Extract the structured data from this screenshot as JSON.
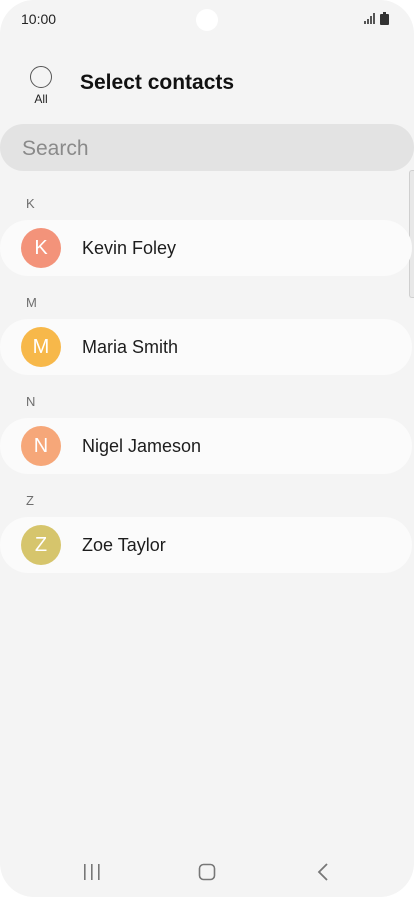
{
  "status_bar": {
    "time": "10:00"
  },
  "header": {
    "select_all_label": "All",
    "title": "Select contacts"
  },
  "search": {
    "placeholder": "Search"
  },
  "sections": [
    {
      "letter": "K",
      "contact": {
        "name": "Kevin Foley",
        "initial": "K",
        "avatar_color": "#f3937a"
      }
    },
    {
      "letter": "M",
      "contact": {
        "name": "Maria Smith",
        "initial": "M",
        "avatar_color": "#f7b84a"
      }
    },
    {
      "letter": "N",
      "contact": {
        "name": "Nigel Jameson",
        "initial": "N",
        "avatar_color": "#f6a779"
      }
    },
    {
      "letter": "Z",
      "contact": {
        "name": "Zoe Taylor",
        "initial": "Z",
        "avatar_color": "#d6c56c"
      }
    }
  ],
  "nav_bar": {
    "icons": [
      "recents-icon",
      "home-icon",
      "back-icon"
    ]
  }
}
